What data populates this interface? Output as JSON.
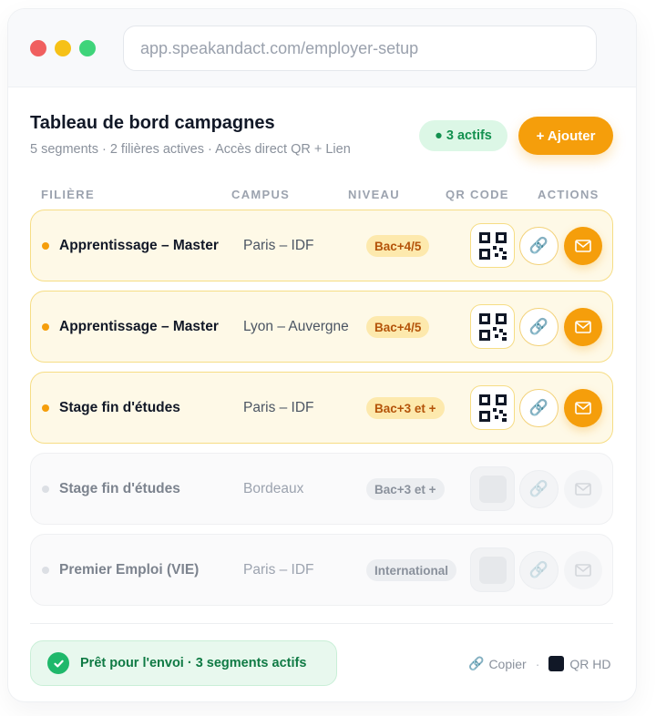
{
  "browser": {
    "url": "app.speakandact.com/employer-setup"
  },
  "header": {
    "title": "Tableau de bord campagnes",
    "subtitle": "5 segments · 2 filières actives · Accès direct QR + Lien",
    "active_badge": "● 3 actifs",
    "add_label": "+ Ajouter"
  },
  "table": {
    "columns": [
      "FILIÈRE",
      "CAMPUS",
      "NIVEAU",
      "QR CODE",
      "ACTIONS"
    ],
    "rows": [
      {
        "filiere": "Apprentissage – Master",
        "campus": "Paris – IDF",
        "niveau": "Bac+4/5",
        "active": true
      },
      {
        "filiere": "Apprentissage – Master",
        "campus": "Lyon – Auvergne",
        "niveau": "Bac+4/5",
        "active": true
      },
      {
        "filiere": "Stage fin d'études",
        "campus": "Paris – IDF",
        "niveau": "Bac+3 et +",
        "active": true
      },
      {
        "filiere": "Stage fin d'études",
        "campus": "Bordeaux",
        "niveau": "Bac+3 et +",
        "active": false
      },
      {
        "filiere": "Premier Emploi (VIE)",
        "campus": "Paris – IDF",
        "niveau": "International",
        "active": false
      }
    ]
  },
  "footer": {
    "ready_text": "Prêt pour l'envoi · 3 segments actifs",
    "copy_label": "Copier",
    "separator": "·",
    "qr_hd_label": "QR HD"
  },
  "colors": {
    "accent": "#f59e0b",
    "success": "#1fb86b"
  },
  "icons": {
    "link": "link-icon",
    "mail": "mail-icon",
    "qr": "qr-code-icon",
    "check": "check-icon"
  }
}
